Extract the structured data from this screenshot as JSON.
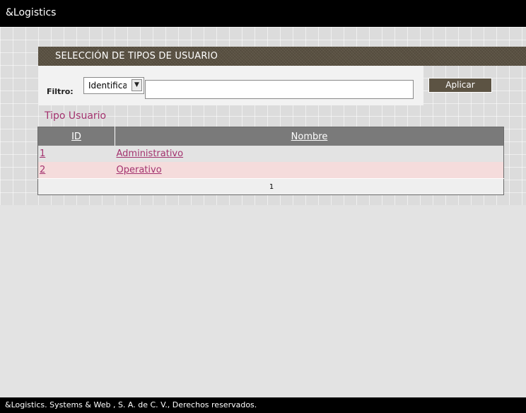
{
  "app": {
    "title": "&Logistics"
  },
  "panel": {
    "title": "SELECCIÓN DE TIPOS DE USUARIO"
  },
  "filter": {
    "label": "Filtro:",
    "field_selected": "Identificador",
    "value": "",
    "apply_label": "Aplicar"
  },
  "section": {
    "title": "Tipo Usuario"
  },
  "table": {
    "headers": {
      "id": "ID",
      "name": "Nombre"
    },
    "rows": [
      {
        "id": "1",
        "name": "Administrativo"
      },
      {
        "id": "2",
        "name": "Operativo"
      }
    ],
    "pager": "1"
  },
  "footer": {
    "text": "&Logistics. Systems & Web , S. A. de C. V., Derechos reservados."
  },
  "colors": {
    "accent_link": "#a3326e",
    "header_brown": "#5a5142",
    "table_header": "#7a7a7a",
    "row_alt": "#f5dcdc"
  },
  "icons": {
    "select_arrow": "chevron-down-icon"
  }
}
